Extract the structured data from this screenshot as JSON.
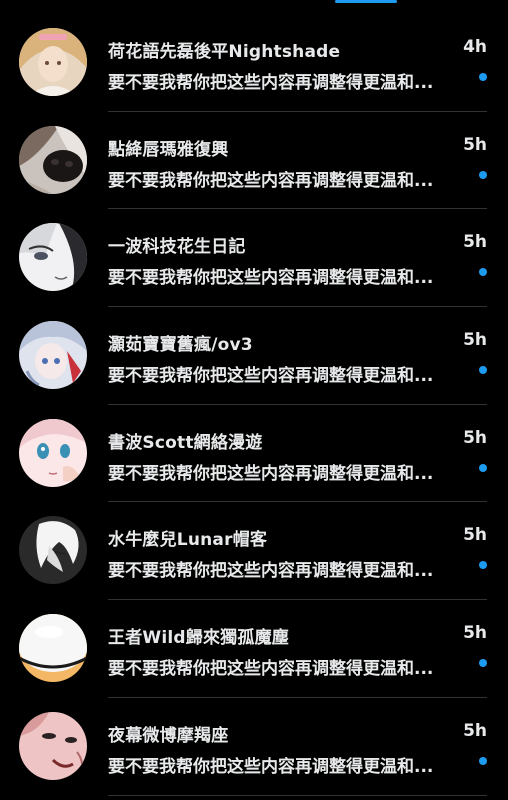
{
  "accent_color": "#1d9bf0",
  "background_color": "#000000",
  "conversations": [
    {
      "name": "荷花語先磊後平Nightshade",
      "time": "4h",
      "preview": "要不要我帮你把这些内容再调整得更温和...",
      "unread": true,
      "avatar_icon": "anime-girl-blonde-avatar"
    },
    {
      "name": "點絳唇瑪雅復興",
      "time": "5h",
      "preview": "要不要我帮你把这些内容再调整得更温和...",
      "unread": true,
      "avatar_icon": "dog-nose-avatar"
    },
    {
      "name": "一波科技花生日記",
      "time": "5h",
      "preview": "要不要我帮你把这些内容再调整得更温和...",
      "unread": true,
      "avatar_icon": "anime-face-sketch-avatar"
    },
    {
      "name": "灝茹寶寶舊瘋/ov3",
      "time": "5h",
      "preview": "要不要我帮你把这些内容再调整得更温和...",
      "unread": true,
      "avatar_icon": "anime-silver-hair-avatar"
    },
    {
      "name": "書波Scott網絡漫遊",
      "time": "5h",
      "preview": "要不要我帮你把这些内容再调整得更温和...",
      "unread": true,
      "avatar_icon": "anime-blue-eyes-avatar"
    },
    {
      "name": "水牛麼兒Lunar帽客",
      "time": "5h",
      "preview": "要不要我帮你把这些内容再调整得更温和...",
      "unread": true,
      "avatar_icon": "anime-white-hair-dark-avatar"
    },
    {
      "name": "王者Wild歸來獨孤魔塵",
      "time": "5h",
      "preview": "要不要我帮你把这些内容再调整得更温和...",
      "unread": true,
      "avatar_icon": "white-egg-avatar"
    },
    {
      "name": "夜幕微博摩羯座",
      "time": "5h",
      "preview": "要不要我帮你把这些内容再调整得更温和...",
      "unread": true,
      "avatar_icon": "pink-face-avatar"
    }
  ]
}
